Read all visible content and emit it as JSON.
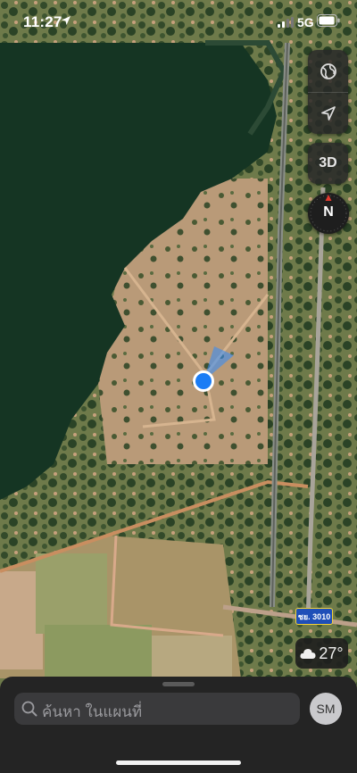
{
  "status_bar": {
    "time": "11:27",
    "network": "5G"
  },
  "map": {
    "type": "satellite",
    "view_mode_label": "3D",
    "compass_label": "N",
    "road_sign": "ชย. 3010"
  },
  "weather": {
    "icon": "cloud-icon",
    "temperature": "27°"
  },
  "search": {
    "placeholder": "ค้นหา ในแผนที่"
  },
  "account": {
    "initials": "SM"
  },
  "colors": {
    "location_dot": "#1a7cf5",
    "sheet": "#242424",
    "compass_red": "#e23a2f"
  }
}
